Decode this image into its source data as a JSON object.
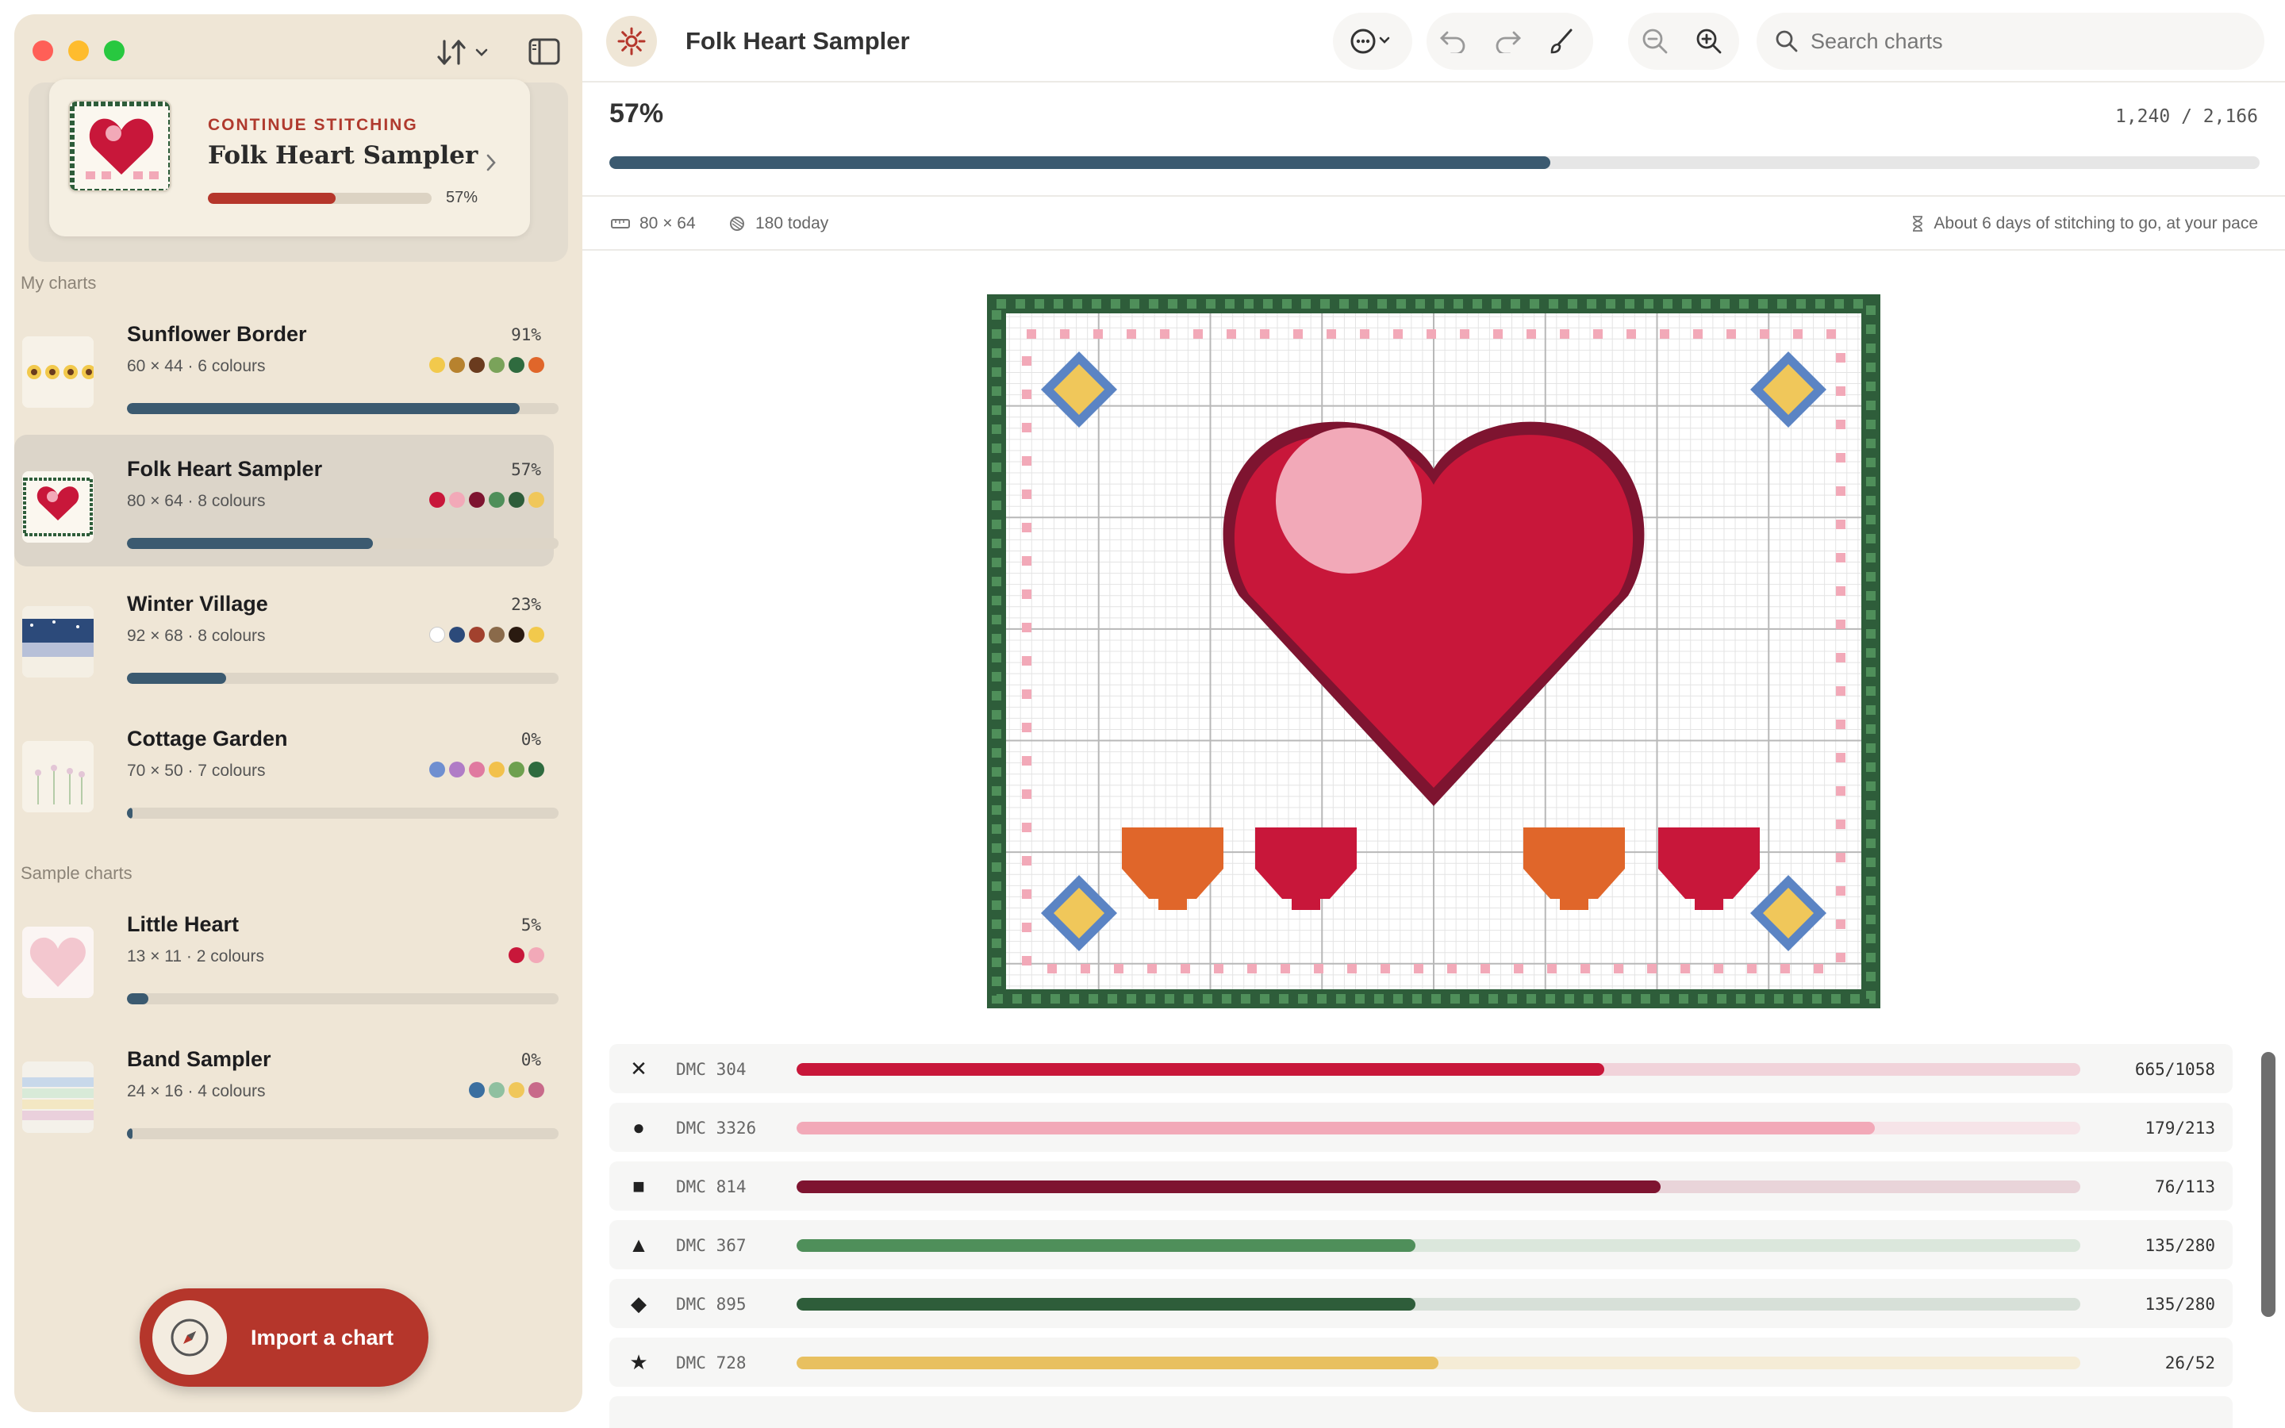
{
  "sidebar": {
    "continue": {
      "kicker": "CONTINUE STITCHING",
      "title": "Folk Heart Sampler",
      "percent_label": "57%",
      "progress": 0.57
    },
    "my_charts_label": "My charts",
    "sample_charts_label": "Sample charts",
    "my_charts": [
      {
        "title": "Sunflower Border",
        "meta": "60 × 44  ·  6 colours",
        "percent": "91%",
        "progress": 0.91,
        "swatches": [
          "#f2c94c",
          "#b7822e",
          "#6a3b1e",
          "#7aa35a",
          "#2f6b3f",
          "#e0662a"
        ]
      },
      {
        "title": "Folk Heart Sampler",
        "meta": "80 × 64  ·  8 colours",
        "percent": "57%",
        "progress": 0.57,
        "swatches": [
          "#c8173a",
          "#f2a9b8",
          "#7e1430",
          "#4f8f5a",
          "#2e5d3a",
          "#f0c75a"
        ]
      },
      {
        "title": "Winter Village",
        "meta": "92 × 68  ·  8 colours",
        "percent": "23%",
        "progress": 0.23,
        "swatches": [
          "#ffffff",
          "#2c4a7a",
          "#a2412e",
          "#8a6a4a",
          "#2a1a10",
          "#f2c94c"
        ]
      },
      {
        "title": "Cottage Garden",
        "meta": "70 × 50  ·  7 colours",
        "percent": "0%",
        "progress": 0.012,
        "swatches": [
          "#6f8fd0",
          "#b07cc6",
          "#e07aa0",
          "#f2c14c",
          "#6ea04f",
          "#2f6b3f"
        ]
      }
    ],
    "sample_charts": [
      {
        "title": "Little Heart",
        "meta": "13 × 11  ·  2 colours",
        "percent": "5%",
        "progress": 0.05,
        "swatches": [
          "#c8173a",
          "#f2a9b8"
        ]
      },
      {
        "title": "Band Sampler",
        "meta": "24 × 16  ·  4 colours",
        "percent": "0%",
        "progress": 0.012,
        "swatches": [
          "#3b6fa0",
          "#8fc0a0",
          "#f0c75a",
          "#c86a8a"
        ]
      }
    ],
    "import_label": "Import a chart"
  },
  "toolbar": {
    "title": "Folk Heart Sampler",
    "search_placeholder": "Search charts"
  },
  "progress": {
    "percent_label": "57%",
    "count_label": "1,240 / 2,166",
    "value": 0.57,
    "dimensions": "80 × 64",
    "today": "180 today",
    "estimate": "About 6 days of stitching to go, at your pace"
  },
  "legend": [
    {
      "symbol": "✕",
      "name": "DMC 304",
      "count": "665/1058",
      "progress": 0.629,
      "color": "#c8173a",
      "track": "#f1d3da"
    },
    {
      "symbol": "●",
      "name": "DMC 3326",
      "count": "179/213",
      "progress": 0.84,
      "color": "#f2a9b8",
      "track": "#f6e4e8"
    },
    {
      "symbol": "■",
      "name": "DMC 814",
      "count": "76/113",
      "progress": 0.673,
      "color": "#7e1430",
      "track": "#e9d4d9"
    },
    {
      "symbol": "▲",
      "name": "DMC 367",
      "count": "135/280",
      "progress": 0.482,
      "color": "#4f8f5a",
      "track": "#dbe7dc"
    },
    {
      "symbol": "◆",
      "name": "DMC 895",
      "count": "135/280",
      "progress": 0.482,
      "color": "#2e5d3a",
      "track": "#d7e0d8"
    },
    {
      "symbol": "★",
      "name": "DMC 728",
      "count": "26/52",
      "progress": 0.5,
      "color": "#e8c060",
      "track": "#f5ecd6"
    }
  ],
  "colors": {
    "accent": "#b5362b",
    "progress": "#3b5a70",
    "heart": "#c8173a",
    "heart_dark": "#7e1430",
    "heart_light": "#f2a9b8",
    "border_green": "#2e5d3a",
    "border_green_light": "#4f8f5a",
    "tulip_orange": "#e0662a",
    "star_gold": "#f0c75a",
    "star_blue": "#5b84c4"
  }
}
